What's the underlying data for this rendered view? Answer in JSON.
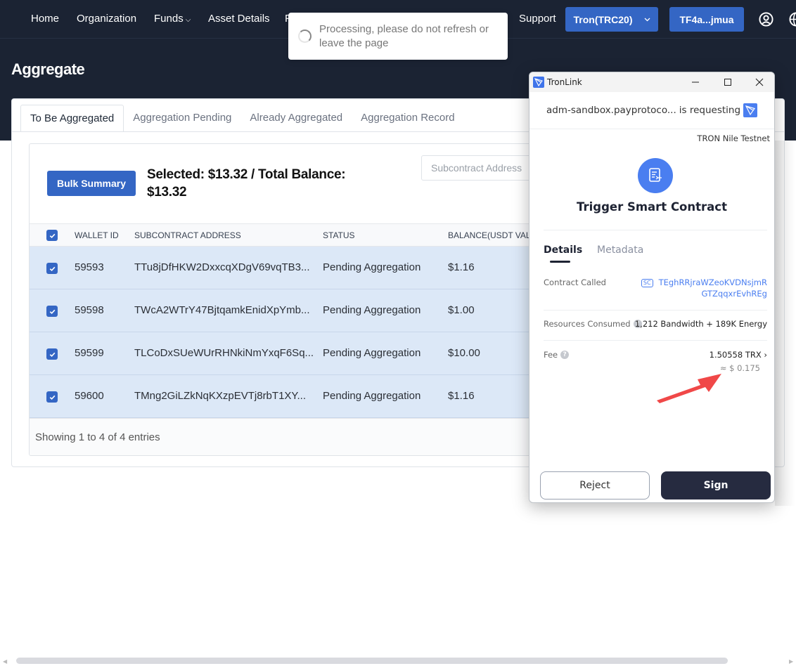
{
  "nav": {
    "items": [
      {
        "label": "Home"
      },
      {
        "label": "Organization"
      },
      {
        "label": "Funds",
        "has_dropdown": true
      },
      {
        "label": "Asset Details"
      },
      {
        "label": "F"
      },
      {
        "label": "Support"
      }
    ],
    "network_select": "Tron(TRC20)",
    "wallet_address": "TF4a...jmua",
    "icons": [
      "user-icon",
      "globe-icon"
    ]
  },
  "page": {
    "title": "Aggregate"
  },
  "tabs": [
    {
      "label": "To Be Aggregated",
      "active": true
    },
    {
      "label": "Aggregation Pending",
      "active": false
    },
    {
      "label": "Already Aggregated",
      "active": false
    },
    {
      "label": "Aggregation Record",
      "active": false
    }
  ],
  "toolbar": {
    "bulk_button": "Bulk Summary",
    "summary_text": "Selected: $13.32 / Total Balance: $13.32",
    "search_placeholder": "Subcontract Address"
  },
  "table": {
    "select_all_checked": true,
    "columns": [
      "WALLET ID",
      "SUBCONTRACT ADDRESS",
      "STATUS",
      "BALANCE(USDT VALUA"
    ],
    "rows": [
      {
        "checked": true,
        "wallet_id": "59593",
        "address": "TTu8jDfHKW2DxxcqXDgV69vqTB3...",
        "status": "Pending Aggregation",
        "balance": "$1.16"
      },
      {
        "checked": true,
        "wallet_id": "59598",
        "address": "TWcA2WTrY47BjtqamkEnidXpYmb...",
        "status": "Pending Aggregation",
        "balance": "$1.00"
      },
      {
        "checked": true,
        "wallet_id": "59599",
        "address": "TLCoDxSUeWUrRHNkiNmYxqF6Sq...",
        "status": "Pending Aggregation",
        "balance": "$10.00"
      },
      {
        "checked": true,
        "wallet_id": "59600",
        "address": "TMng2GiLZkNqKXzpEVTj8rbT1XY...",
        "status": "Pending Aggregation",
        "balance": "$1.16"
      }
    ],
    "footer": "Showing 1 to 4 of 4 entries"
  },
  "toast": {
    "message": "Processing, please do not refresh or leave the page"
  },
  "tronlink": {
    "window_title": "TronLink",
    "requesting_site": "adm-sandbox.payprotoco...",
    "requesting_label": "is requesting",
    "network": "TRON Nile Testnet",
    "heading": "Trigger Smart Contract",
    "tabs": [
      {
        "label": "Details",
        "active": true
      },
      {
        "label": "Metadata",
        "active": false
      }
    ],
    "details": {
      "contract_called_label": "Contract Called",
      "contract_badge": "SC",
      "contract_line1": "TEghRRjraWZeoKVDNsjmR",
      "contract_line2": "GTZqqxrEvhREg",
      "resources_label": "Resources Consumed",
      "resources_value": "1,212 Bandwidth + 189K Energy",
      "fee_label": "Fee",
      "fee_value": "1.50558 TRX",
      "fee_usd": "≈ $ 0.175"
    },
    "reject_button": "Reject",
    "sign_button": "Sign"
  },
  "annotation": {
    "arrow_color": "#f04848"
  },
  "colors": {
    "primary": "#3466c4",
    "header_bg": "#1b2333",
    "row_selected": "#dce8f7",
    "tronlink_blue": "#4a7ef0",
    "sign_button": "#262b40"
  }
}
